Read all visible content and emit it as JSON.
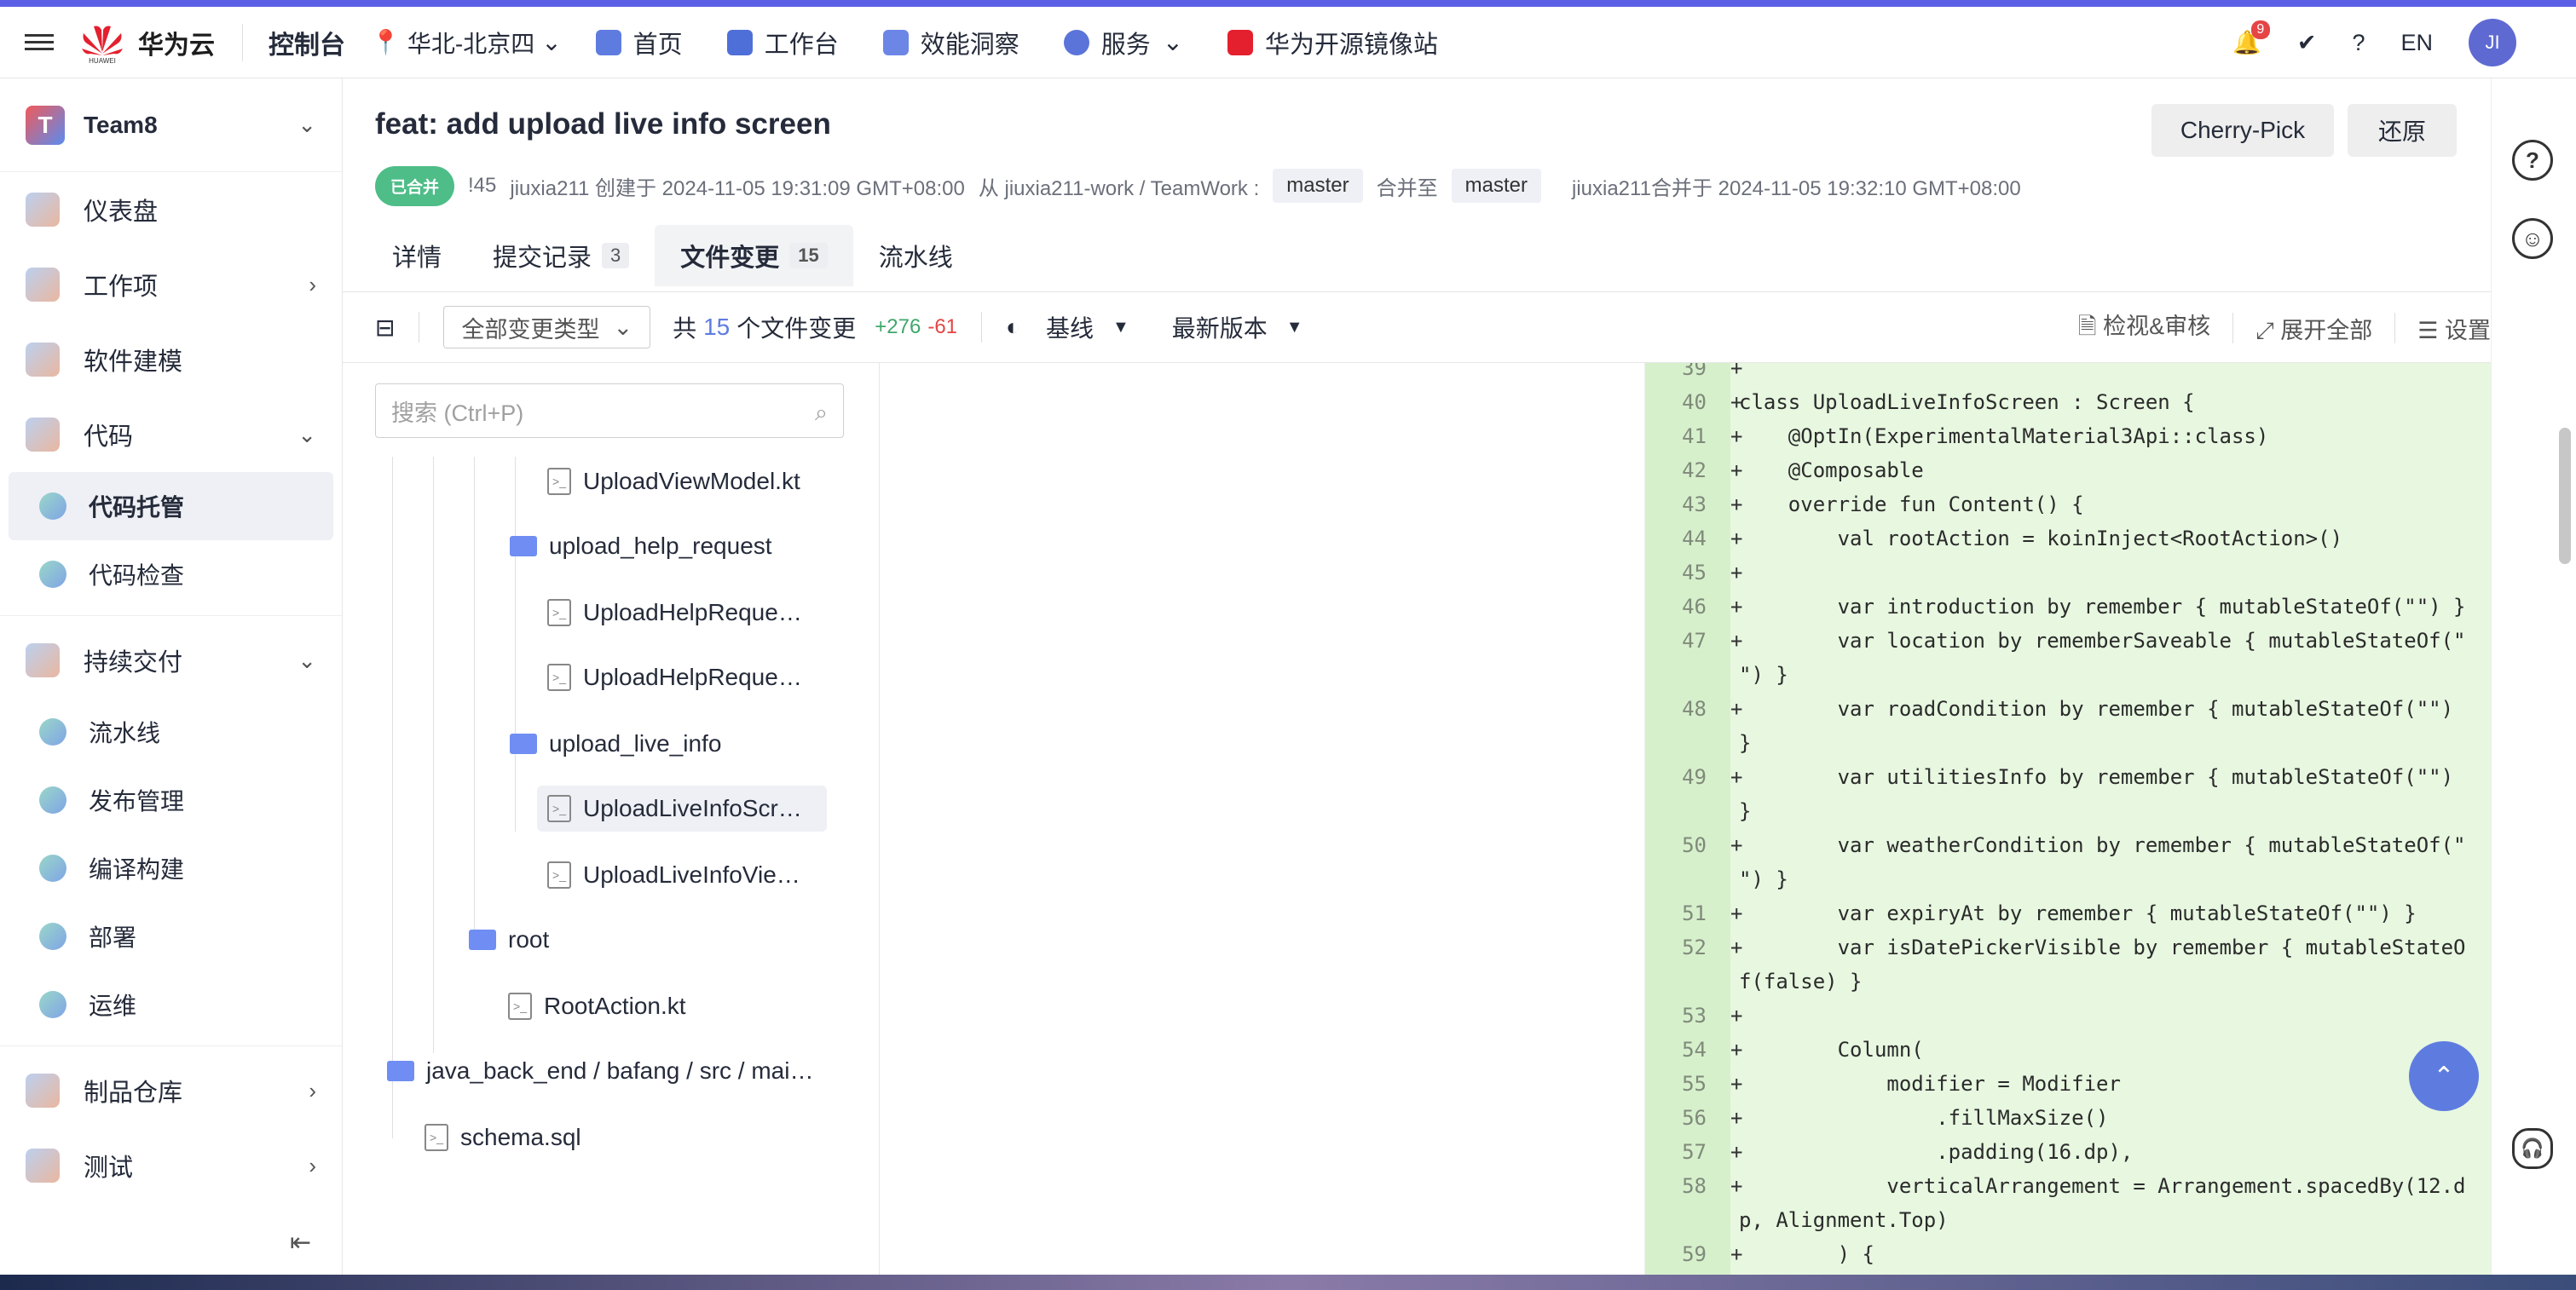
{
  "topbar": {
    "brand": "华为云",
    "brand_sub": "HUAWEI",
    "console": "控制台",
    "region": "华北-北京四",
    "nav": [
      "首页",
      "工作台",
      "效能洞察",
      "服务",
      "华为开源镜像站"
    ],
    "notification_count": "9",
    "lang": "EN",
    "avatar": "JI"
  },
  "sidebar": {
    "team": "Team8",
    "items": [
      {
        "label": "仪表盘"
      },
      {
        "label": "工作项"
      },
      {
        "label": "软件建模"
      },
      {
        "label": "代码"
      },
      {
        "label": "代码托管"
      },
      {
        "label": "代码检查"
      },
      {
        "label": "持续交付"
      },
      {
        "label": "流水线"
      },
      {
        "label": "发布管理"
      },
      {
        "label": "编译构建"
      },
      {
        "label": "部署"
      },
      {
        "label": "运维"
      },
      {
        "label": "制品仓库"
      },
      {
        "label": "测试"
      }
    ]
  },
  "mr": {
    "title": "feat: add upload live info screen",
    "cherry_pick": "Cherry-Pick",
    "revert": "还原",
    "status": "已合并",
    "id": "!45",
    "created": "jiuxia211 创建于 2024-11-05 19:31:09 GMT+08:00",
    "from": "从 jiuxia211-work / TeamWork :",
    "source_branch": "master",
    "merge_to": "合并至",
    "target_branch": "master",
    "merged": "jiuxia211合并于 2024-11-05 19:32:10 GMT+08:00"
  },
  "tabs": [
    {
      "label": "详情",
      "count": ""
    },
    {
      "label": "提交记录",
      "count": "3"
    },
    {
      "label": "文件变更",
      "count": "15"
    },
    {
      "label": "流水线",
      "count": ""
    }
  ],
  "toolbar": {
    "change_type": "全部变更类型",
    "total_prefix": "共",
    "total_count": "15",
    "total_suffix": "个文件变更",
    "added": "+276",
    "removed": "-61",
    "baseline": "基线",
    "version": "最新版本",
    "review": "检视&审核",
    "expand": "展开全部",
    "settings": "设置"
  },
  "filetree": {
    "search_placeholder": "搜索 (Ctrl+P)",
    "rows": [
      {
        "name": "UploadViewModel.kt",
        "type": "file"
      },
      {
        "name": "upload_help_request",
        "type": "dir"
      },
      {
        "name": "UploadHelpReque…",
        "type": "file"
      },
      {
        "name": "UploadHelpReque…",
        "type": "file"
      },
      {
        "name": "upload_live_info",
        "type": "dir"
      },
      {
        "name": "UploadLiveInfoScr…",
        "type": "file"
      },
      {
        "name": "UploadLiveInfoVie…",
        "type": "file"
      },
      {
        "name": "root",
        "type": "dir"
      },
      {
        "name": "RootAction.kt",
        "type": "file"
      },
      {
        "name": "java_back_end / bafang / src / mai…",
        "type": "dir"
      },
      {
        "name": "schema.sql",
        "type": "file"
      }
    ]
  },
  "code_lines": [
    {
      "ln": "39",
      "text": ""
    },
    {
      "ln": "40",
      "text": "class UploadLiveInfoScreen : Screen {"
    },
    {
      "ln": "41",
      "text": "    @OptIn(ExperimentalMaterial3Api::class)"
    },
    {
      "ln": "42",
      "text": "    @Composable"
    },
    {
      "ln": "43",
      "text": "    override fun Content() {"
    },
    {
      "ln": "44",
      "text": "        val rootAction = koinInject<RootAction>()"
    },
    {
      "ln": "45",
      "text": ""
    },
    {
      "ln": "46",
      "text": "        var introduction by remember { mutableStateOf(\"\") }"
    },
    {
      "ln": "47",
      "text": "        var location by rememberSaveable { mutableStateOf(\""
    },
    {
      "ln": "",
      "text": "\") }"
    },
    {
      "ln": "48",
      "text": "        var roadCondition by remember { mutableStateOf(\"\")"
    },
    {
      "ln": "",
      "text": "}"
    },
    {
      "ln": "49",
      "text": "        var utilitiesInfo by remember { mutableStateOf(\"\")"
    },
    {
      "ln": "",
      "text": "}"
    },
    {
      "ln": "50",
      "text": "        var weatherCondition by remember { mutableStateOf(\""
    },
    {
      "ln": "",
      "text": "\") }"
    },
    {
      "ln": "51",
      "text": "        var expiryAt by remember { mutableStateOf(\"\") }"
    },
    {
      "ln": "52",
      "text": "        var isDatePickerVisible by remember { mutableStateO"
    },
    {
      "ln": "",
      "text": "f(false) }"
    },
    {
      "ln": "53",
      "text": ""
    },
    {
      "ln": "54",
      "text": "        Column("
    },
    {
      "ln": "55",
      "text": "            modifier = Modifier"
    },
    {
      "ln": "56",
      "text": "                .fillMaxSize()"
    },
    {
      "ln": "57",
      "text": "                .padding(16.dp),"
    },
    {
      "ln": "58",
      "text": "            verticalArrangement = Arrangement.spacedBy(12.d"
    },
    {
      "ln": "",
      "text": "p, Alignment.Top)"
    },
    {
      "ln": "59",
      "text": "        ) {"
    }
  ]
}
